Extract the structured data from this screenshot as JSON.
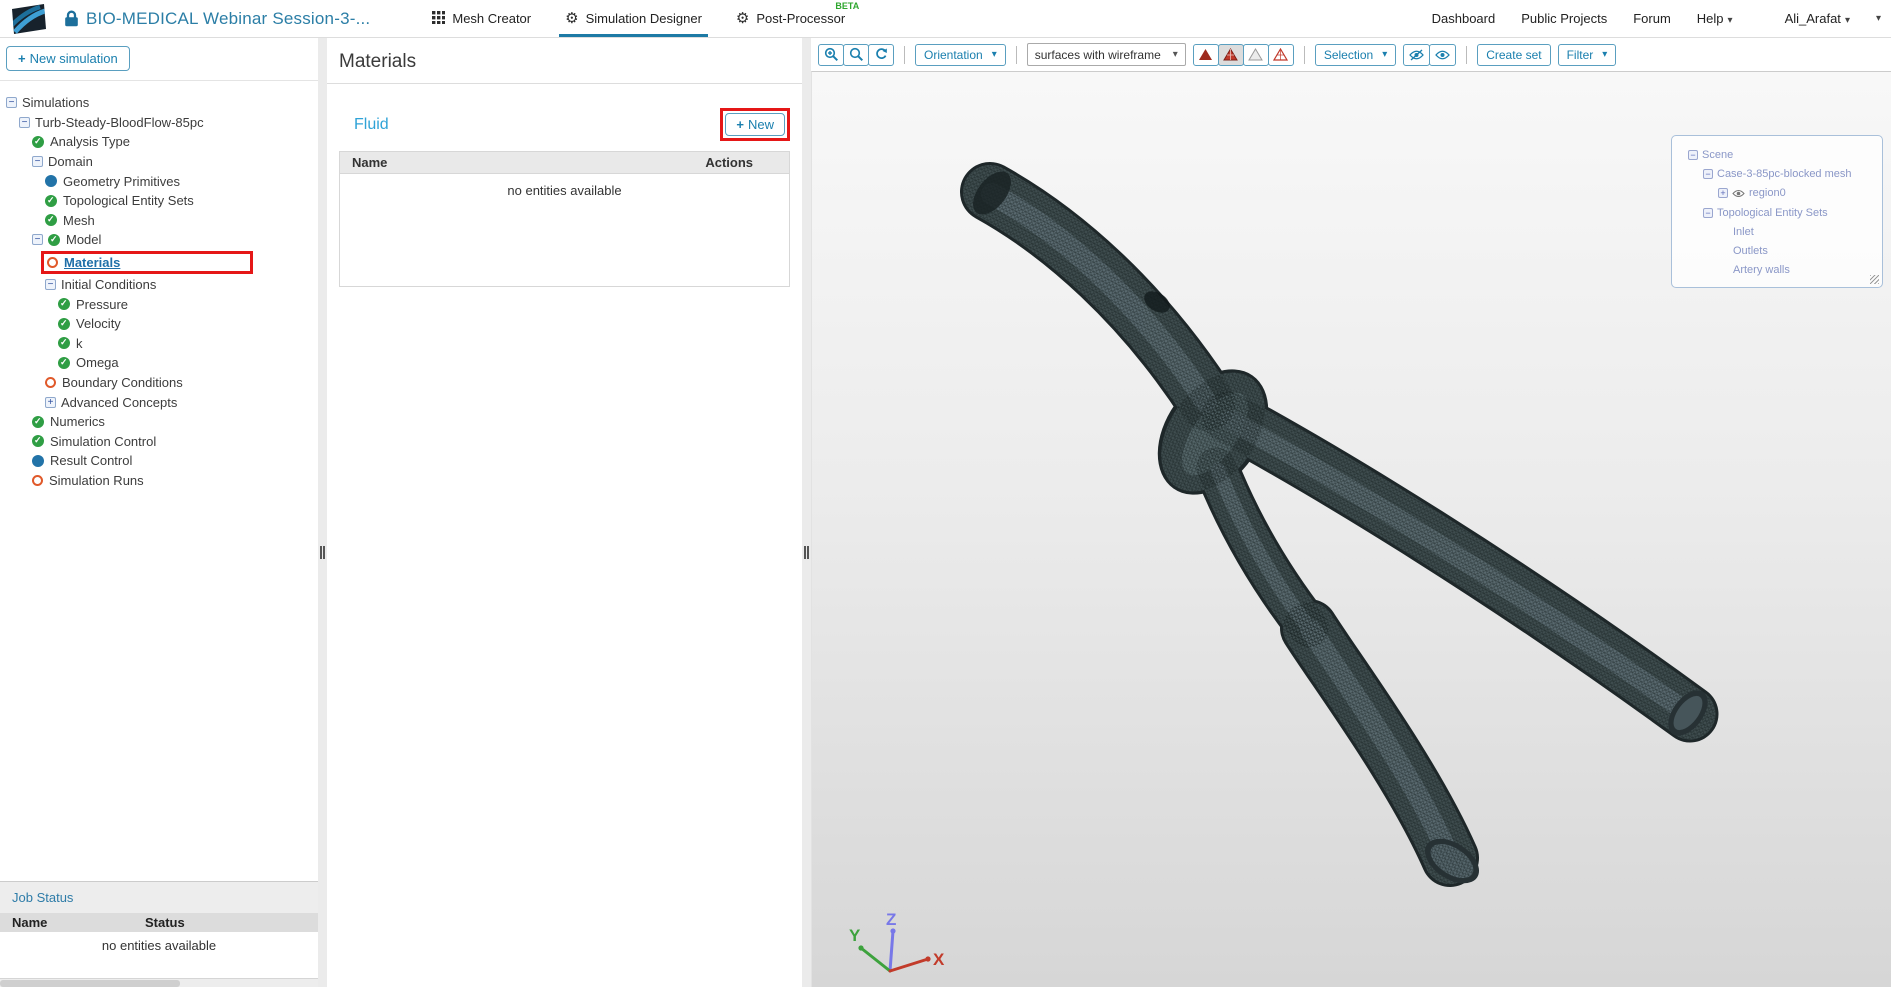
{
  "header": {
    "title": "BIO-MEDICAL Webinar Session-3-...",
    "tabs": [
      {
        "label": "Mesh Creator",
        "icon": "grid",
        "active": false
      },
      {
        "label": "Simulation Designer",
        "icon": "gears",
        "active": true
      },
      {
        "label": "Post-Processor",
        "icon": "gear",
        "active": false,
        "badge": "BETA"
      }
    ],
    "links": [
      {
        "label": "Dashboard"
      },
      {
        "label": "Public Projects"
      },
      {
        "label": "Forum"
      }
    ],
    "help": {
      "label": "Help"
    },
    "user": {
      "label": "Ali_Arafat"
    }
  },
  "sidebar": {
    "new_simulation": {
      "plus": "+",
      "label": "New simulation"
    },
    "tree": [
      {
        "label": "Simulations",
        "depth": 0,
        "expander": "minus"
      },
      {
        "label": "Turb-Steady-BloodFlow-85pc",
        "depth": 1,
        "expander": "minus"
      },
      {
        "label": "Analysis Type",
        "depth": 2,
        "icon": "check"
      },
      {
        "label": "Domain",
        "depth": 2,
        "expander": "minus"
      },
      {
        "label": "Geometry Primitives",
        "depth": 3,
        "icon": "dot-blue"
      },
      {
        "label": "Topological Entity Sets",
        "depth": 3,
        "icon": "check"
      },
      {
        "label": "Mesh",
        "depth": 3,
        "icon": "check"
      },
      {
        "label": "Model",
        "depth": 2,
        "expander": "minus",
        "icon": "check"
      },
      {
        "label": "Materials",
        "depth": 3,
        "icon": "circle-orange",
        "selected": true
      },
      {
        "label": "Initial Conditions",
        "depth": 3,
        "expander": "minus"
      },
      {
        "label": "Pressure",
        "depth": 4,
        "icon": "check"
      },
      {
        "label": "Velocity",
        "depth": 4,
        "icon": "check"
      },
      {
        "label": "k",
        "depth": 4,
        "icon": "check"
      },
      {
        "label": "Omega",
        "depth": 4,
        "icon": "check"
      },
      {
        "label": "Boundary Conditions",
        "depth": 3,
        "icon": "circle-orange"
      },
      {
        "label": "Advanced Concepts",
        "depth": 3,
        "expander": "plus"
      },
      {
        "label": "Numerics",
        "depth": 2,
        "icon": "check"
      },
      {
        "label": "Simulation Control",
        "depth": 2,
        "icon": "check"
      },
      {
        "label": "Result Control",
        "depth": 2,
        "icon": "dot-blue"
      },
      {
        "label": "Simulation Runs",
        "depth": 2,
        "icon": "circle-orange"
      }
    ],
    "job_status": {
      "title": "Job Status",
      "name_col": "Name",
      "status_col": "Status",
      "empty": "no entities available"
    }
  },
  "materials": {
    "title": "Materials",
    "section": "Fluid",
    "new_plus": "+",
    "new_label": "New",
    "name_col": "Name",
    "actions_col": "Actions",
    "empty": "no entities available"
  },
  "viewer": {
    "toolbar": {
      "orientation": "Orientation",
      "view_mode": "surfaces with wireframe",
      "selection": "Selection",
      "create_set": "Create set",
      "filter": "Filter"
    },
    "scene": [
      {
        "label": "Scene",
        "depth": 0,
        "expander": "minus"
      },
      {
        "label": "Case-3-85pc-blocked mesh",
        "depth": 1,
        "expander": "minus"
      },
      {
        "label": "region0",
        "depth": 2,
        "expander": "plus",
        "eye": true
      },
      {
        "label": "Topological Entity Sets",
        "depth": 1,
        "expander": "minus"
      },
      {
        "label": "Inlet",
        "depth": 3
      },
      {
        "label": "Outlets",
        "depth": 3
      },
      {
        "label": "Artery walls",
        "depth": 3
      }
    ],
    "axis": {
      "x": "X",
      "y": "Y",
      "z": "Z"
    },
    "colors": {
      "accent": "#1a7fae",
      "mesh_surface": "#3f4d4f",
      "annotation": "#e51717",
      "beta_green": "#2ea62e"
    }
  }
}
